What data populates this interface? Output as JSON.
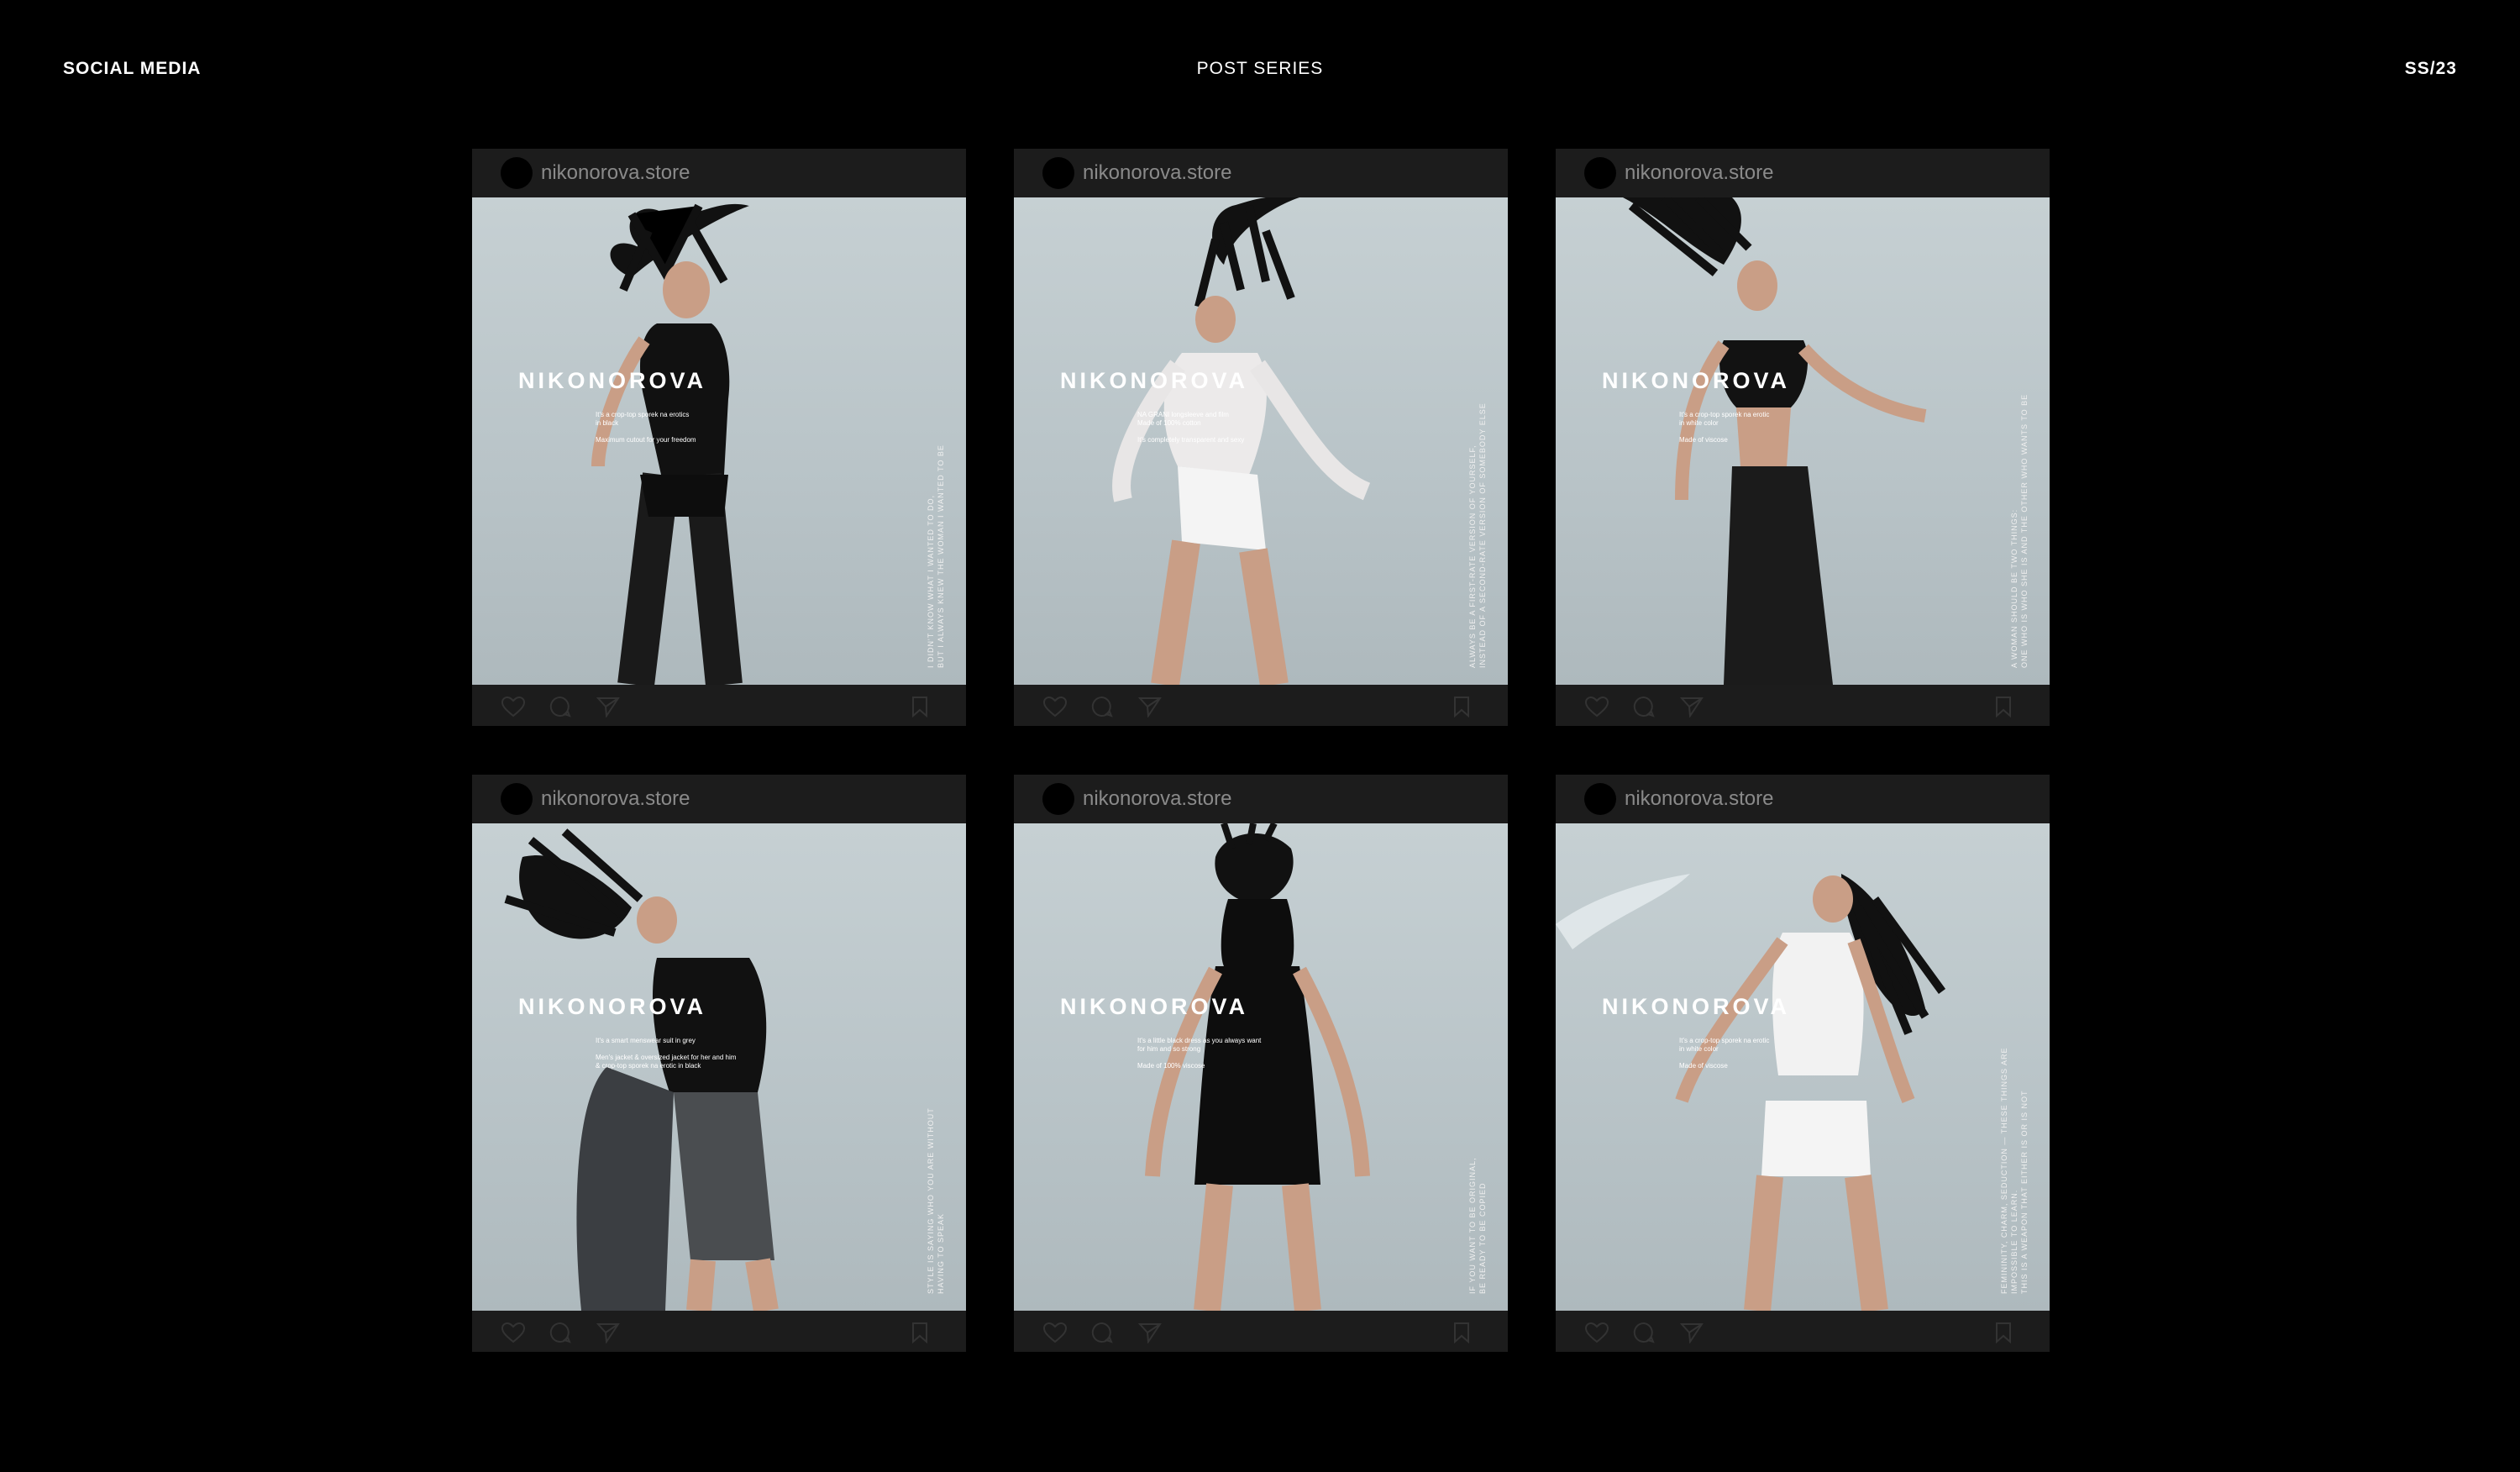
{
  "header": {
    "left": "SOCIAL MEDIA",
    "center": "POST SERIES",
    "right": "SS/23"
  },
  "brand": "NIKONOROVA",
  "posts": [
    {
      "handle": "nikonorova.store",
      "copy": "It's a crop-top sporek na erotics\nin black\n\nMaximum cutout for your freedom",
      "vertical": "I DIDN'T KNOW WHAT I WANTED TO DO,\nBUT I ALWAYS KNEW THE WOMAN I WANTED TO BE",
      "outfit": "black"
    },
    {
      "handle": "nikonorova.store",
      "copy": "NA GRANI longsleeve and film\nMade of 100% cotton\n\nIt's completely transparent and sexy",
      "vertical": "ALWAYS BE A FIRST-RATE VERSION OF YOURSELF,\nINSTEAD OF A SECOND-RATE VERSION OF SOMEBODY ELSE",
      "outfit": "white"
    },
    {
      "handle": "nikonorova.store",
      "copy": "It's a crop-top sporek na erotic\nin white color\n\nMade of viscose",
      "vertical": "A WOMAN SHOULD BE TWO THINGS:\nONE WHO IS WHO SHE IS AND THE OTHER WHO WANTS TO BE",
      "outfit": "crop"
    },
    {
      "handle": "nikonorova.store",
      "copy": "It's a smart menswear suit in grey\n\nMen's jacket & oversized jacket for her and him\n& crop-top sporek na erotic in black",
      "vertical": "STYLE IS SAYING WHO YOU ARE WITHOUT\nHAVING TO SPEAK",
      "outfit": "grey"
    },
    {
      "handle": "nikonorova.store",
      "copy": "It's a little black dress as you always want\nfor him and so strong\n\nMade of 100% viscose",
      "vertical": "IF YOU WANT TO BE ORIGINAL,\nBE READY TO BE COPIED",
      "outfit": "dress"
    },
    {
      "handle": "nikonorova.store",
      "copy": "It's a crop-top sporek na erotic\nin white color\n\nMade of viscose",
      "vertical": "FEMININITY, CHARM, SEDUCTION — THESE THINGS ARE IMPOSSIBLE TO LEARN.\nTHIS IS A WEAPON THAT EITHER IS OR IS NOT",
      "outfit": "whiteset"
    }
  ],
  "icons": [
    "heart-icon",
    "comment-icon",
    "share-icon",
    "bookmark-icon"
  ],
  "colors": {
    "background": "#000000",
    "card": "#1c1c1c",
    "photo_bg": "#c3cdd1",
    "handle": "#8a8a8a"
  }
}
